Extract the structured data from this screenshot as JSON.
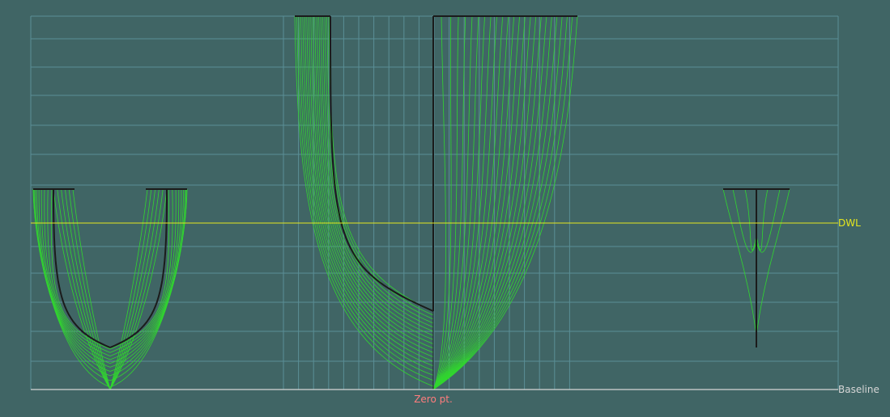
{
  "view": {
    "type": "body-plan",
    "background_color": "#406565"
  },
  "labels": {
    "dwl": "DWL",
    "baseline": "Baseline",
    "zero_point": "Zero pt."
  },
  "colors": {
    "grid": "#5a8f96",
    "station_line": "#31d62f",
    "outline": "#1b1b1b",
    "dwl": "#e4e61f",
    "baseline": "#d6d6d6",
    "zero_point": "#ff7d7d"
  }
}
